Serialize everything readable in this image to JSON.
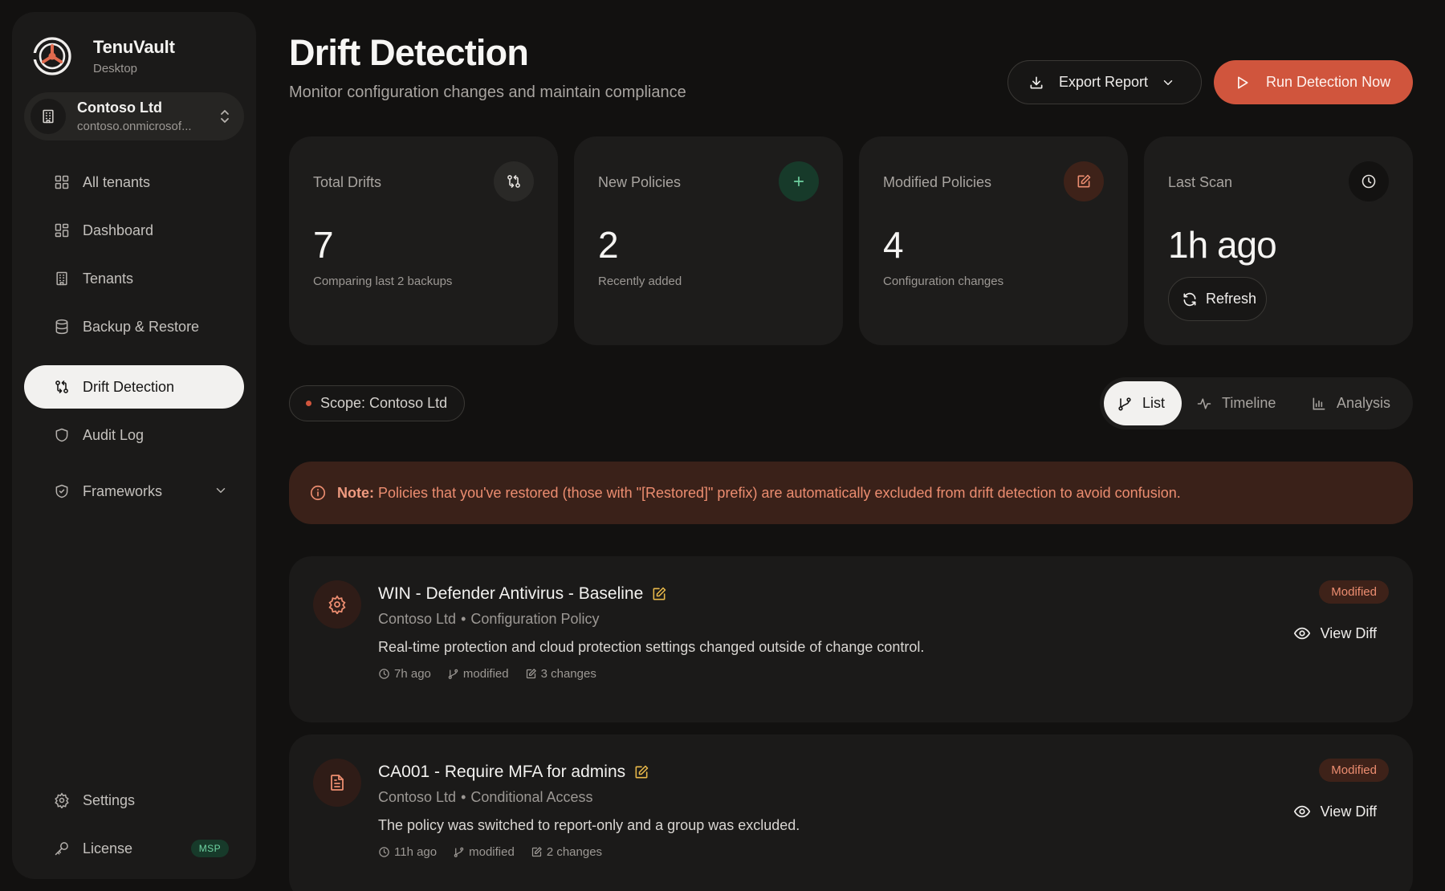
{
  "app": {
    "name": "TenuVault",
    "subtitle": "Desktop"
  },
  "tenant": {
    "name": "Contoso Ltd",
    "domain": "contoso.onmicrosof..."
  },
  "nav": {
    "items": [
      {
        "label": "All tenants",
        "icon": "grid-icon"
      },
      {
        "label": "Dashboard",
        "icon": "dashboard-icon"
      },
      {
        "label": "Tenants",
        "icon": "building-icon"
      },
      {
        "label": "Backup & Restore",
        "icon": "database-icon"
      },
      {
        "label": "Drift Detection",
        "icon": "git-compare-icon",
        "active": true
      },
      {
        "label": "Audit Log",
        "icon": "shield-icon"
      },
      {
        "label": "Frameworks",
        "icon": "shield-check-icon"
      }
    ],
    "bottom": [
      {
        "label": "Settings",
        "icon": "gear-icon"
      },
      {
        "label": "License",
        "icon": "key-icon",
        "badge": "MSP"
      }
    ]
  },
  "header": {
    "title": "Drift Detection",
    "subtitle": "Monitor configuration changes and maintain compliance",
    "export_label": "Export Report",
    "run_label": "Run Detection Now"
  },
  "stats": [
    {
      "label": "Total Drifts",
      "value": "7",
      "desc": "Comparing last 2 backups",
      "icon": "git-compare-icon"
    },
    {
      "label": "New Policies",
      "value": "2",
      "desc": "Recently added",
      "icon": "plus-icon"
    },
    {
      "label": "Modified Policies",
      "value": "4",
      "desc": "Configuration changes",
      "icon": "edit-icon"
    },
    {
      "label": "Last Scan",
      "value": "1h ago",
      "action": "Refresh",
      "icon": "clock-icon"
    }
  ],
  "scope": {
    "label": "Scope: Contoso Ltd"
  },
  "view_tabs": [
    {
      "label": "List",
      "active": true
    },
    {
      "label": "Timeline"
    },
    {
      "label": "Analysis"
    }
  ],
  "note": {
    "prefix": "Note:",
    "text": "Policies that you've restored (those with \"[Restored]\" prefix) are automatically excluded from drift detection to avoid confusion."
  },
  "drifts": [
    {
      "title": "WIN - Defender Antivirus - Baseline",
      "tenant": "Contoso Ltd",
      "type": "Configuration Policy",
      "description": "Real-time protection and cloud protection settings changed outside of change control.",
      "time": "7h ago",
      "change_type": "modified",
      "changes": "3 changes",
      "status": "Modified",
      "action": "View Diff",
      "icon": "gear-icon"
    },
    {
      "title": "CA001 - Require MFA for admins",
      "tenant": "Contoso Ltd",
      "type": "Conditional Access",
      "description": "The policy was switched to report-only and a group was excluded.",
      "time": "11h ago",
      "change_type": "modified",
      "changes": "2 changes",
      "status": "Modified",
      "action": "View Diff",
      "icon": "document-icon"
    }
  ],
  "colors": {
    "accent": "#d0553d",
    "background": "#121110",
    "surface": "#1d1c1b",
    "success": "#6fd3a2",
    "warning": "#e8b84a"
  }
}
